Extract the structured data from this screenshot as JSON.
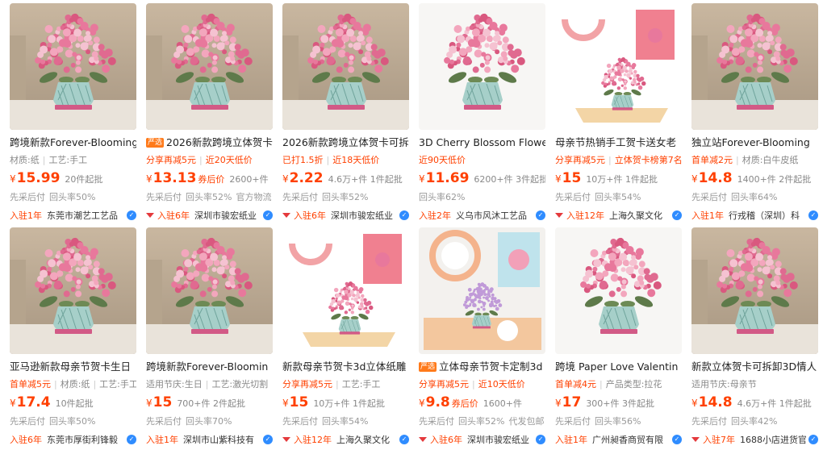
{
  "products": [
    {
      "title": "跨境新款Forever-Blooming",
      "ad": "",
      "line": [
        {
          "t": "材质:纸",
          "red": false
        },
        {
          "t": "工艺:手工",
          "red": false
        }
      ],
      "price": "15.99",
      "coupon": "",
      "sold": "20件起批",
      "service": [
        "先采后付",
        "回头率50%"
      ],
      "badge": "入驻1年",
      "triangle": false,
      "shop": "东莞市潮艺工艺品",
      "img": "warm"
    },
    {
      "title": "2026新款跨境立体贺卡",
      "ad": "严选",
      "line": [
        {
          "t": "分享再减5元",
          "red": true
        },
        {
          "t": "近20天低价",
          "red": true
        }
      ],
      "price": "13.13",
      "coupon": "券后价",
      "sold": "2600+件",
      "service": [
        "先采后付",
        "回头率52%",
        "官方物流"
      ],
      "badge": "入驻6年",
      "triangle": true,
      "shop": "深圳市骏宏纸业",
      "img": "warm"
    },
    {
      "title": "2026新款跨境立体贺卡可拆",
      "ad": "",
      "line": [
        {
          "t": "已打1.5折",
          "red": true
        },
        {
          "t": "近18天低价",
          "red": true
        }
      ],
      "price": "2.22",
      "coupon": "",
      "sold": "4.6万+件 1件起批",
      "service": [
        "先采后付",
        "回头率52%"
      ],
      "badge": "入驻6年",
      "triangle": true,
      "shop": "深圳市骏宏纸业",
      "img": "warm"
    },
    {
      "title": "3D Cherry Blossom Flowe",
      "ad": "",
      "line": [
        {
          "t": "近90天低价",
          "red": true
        }
      ],
      "price": "11.69",
      "coupon": "",
      "sold": "6200+件 3件起批",
      "service": [
        "回头率62%"
      ],
      "badge": "入驻2年",
      "triangle": false,
      "shop": "义乌市风沐工艺品",
      "img": "white"
    },
    {
      "title": "母亲节热销手工贺卡送女老",
      "ad": "",
      "line": [
        {
          "t": "分享再减5元",
          "red": true
        },
        {
          "t": "立体贺卡榜第7名",
          "red": true
        }
      ],
      "price": "15",
      "coupon": "",
      "sold": "10万+件 1件起批",
      "service": [
        "先采后付",
        "回头率54%"
      ],
      "badge": "入驻12年",
      "triangle": true,
      "shop": "上海久聚文化",
      "img": "diagram"
    },
    {
      "title": "独立站Forever-Blooming",
      "ad": "",
      "line": [
        {
          "t": "首单减2元",
          "red": true
        },
        {
          "t": "材质:白牛皮纸",
          "red": false
        }
      ],
      "price": "14.8",
      "coupon": "",
      "sold": "1400+件 2件起批",
      "service": [
        "先采后付",
        "回头率64%"
      ],
      "badge": "入驻1年",
      "triangle": false,
      "shop": "行戎稽（深圳）科",
      "img": "warm"
    },
    {
      "title": "亚马逊新款母亲节贺卡生日",
      "ad": "",
      "line": [
        {
          "t": "首单减5元",
          "red": true
        },
        {
          "t": "材质:纸",
          "red": false
        },
        {
          "t": "工艺:手工",
          "red": false
        }
      ],
      "price": "17.4",
      "coupon": "",
      "sold": "10件起批",
      "service": [
        "先采后付",
        "回头率50%"
      ],
      "badge": "入驻6年",
      "triangle": false,
      "shop": "东莞市厚街利锋毅",
      "img": "warm"
    },
    {
      "title": "跨境新款Forever-Bloomin",
      "ad": "",
      "line": [
        {
          "t": "适用节庆:生日",
          "red": false
        },
        {
          "t": "工艺:激光切割",
          "red": false
        }
      ],
      "price": "15",
      "coupon": "",
      "sold": "700+件 2件起批",
      "service": [
        "先采后付",
        "回头率70%"
      ],
      "badge": "入驻1年",
      "triangle": false,
      "shop": "深圳市山紫科技有",
      "img": "warm"
    },
    {
      "title": "新款母亲节贺卡3d立体纸雕",
      "ad": "",
      "line": [
        {
          "t": "分享再减5元",
          "red": true
        },
        {
          "t": "工艺:手工",
          "red": false
        }
      ],
      "price": "15",
      "coupon": "",
      "sold": "10万+件 1件起批",
      "service": [
        "先采后付",
        "回头率54%"
      ],
      "badge": "入驻12年",
      "triangle": true,
      "shop": "上海久聚文化",
      "img": "diagram"
    },
    {
      "title": "立体母亲节贺卡定制3d",
      "ad": "严选",
      "line": [
        {
          "t": "分享再减5元",
          "red": true
        },
        {
          "t": "近10天低价",
          "red": true
        }
      ],
      "price": "9.8",
      "coupon": "券后价",
      "sold": "1600+件",
      "service": [
        "先采后付",
        "回头率52%",
        "代发包邮"
      ],
      "badge": "入驻6年",
      "triangle": true,
      "shop": "深圳市骏宏纸业",
      "img": "diagram2"
    },
    {
      "title": "跨境 Paper Love Valentin",
      "ad": "",
      "line": [
        {
          "t": "首单减4元",
          "red": true
        },
        {
          "t": "产品类型:拉花",
          "red": false
        }
      ],
      "price": "17",
      "coupon": "",
      "sold": "300+件 3件起批",
      "service": [
        "先采后付",
        "回头率56%"
      ],
      "badge": "入驻1年",
      "triangle": false,
      "shop": "广州昶香商贸有限",
      "img": "white"
    },
    {
      "title": "新款立体贺卡可拆卸3D情人",
      "ad": "",
      "line": [
        {
          "t": "适用节庆:母亲节",
          "red": false
        }
      ],
      "price": "14.8",
      "coupon": "",
      "sold": "4.6万+件 1件起批",
      "service": [
        "先采后付",
        "回头率42%"
      ],
      "badge": "入驻7年",
      "triangle": true,
      "shop": "1688小店进货官",
      "img": "warm"
    }
  ],
  "currency": "¥",
  "colors": {
    "price": "#ff4000",
    "accent": "#e4393c",
    "verified": "#2f8cff"
  },
  "icons": {
    "verified": "shield-check-icon",
    "crown": "crown-icon"
  }
}
